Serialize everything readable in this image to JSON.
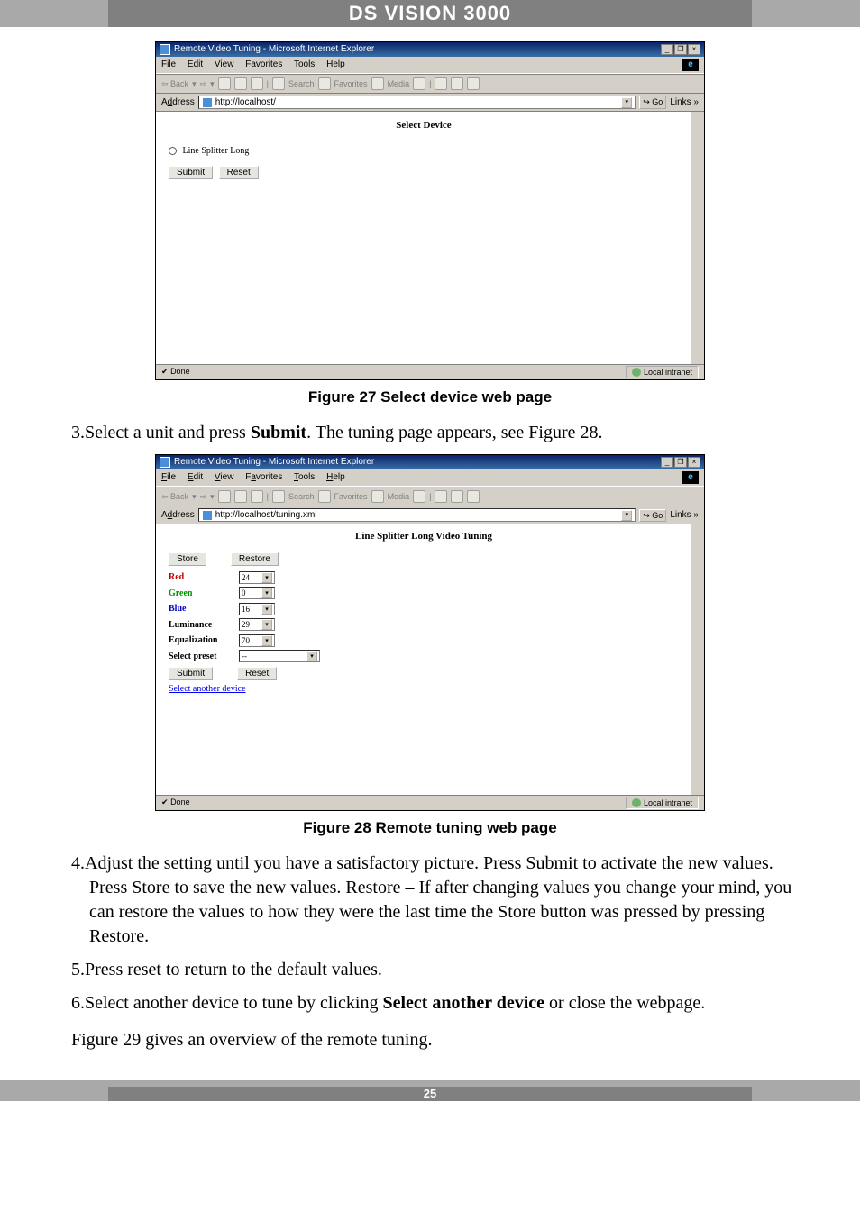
{
  "header": {
    "title": "DS VISION 3000"
  },
  "figure27": {
    "caption": "Figure 27 Select device web page",
    "ie": {
      "title": "Remote Video Tuning - Microsoft Internet Explorer",
      "menu": {
        "file": "File",
        "edit": "Edit",
        "view": "View",
        "favorites": "Favorites",
        "tools": "Tools",
        "help": "Help"
      },
      "toolbar": {
        "back": "Back",
        "search": "Search",
        "favorites": "Favorites",
        "media": "Media"
      },
      "address_label": "Address",
      "address_value": "http://localhost/",
      "go": "Go",
      "links": "Links »",
      "page_title": "Select Device",
      "radio_label": "Line Splitter Long",
      "submit": "Submit",
      "reset": "Reset",
      "status_left": "Done",
      "status_right": "Local intranet"
    }
  },
  "step3": {
    "num": "3.",
    "text_before": "Select a unit and press ",
    "bold": "Submit",
    "text_after": ". The tuning page appears, see Figure 28."
  },
  "figure28": {
    "caption": "Figure 28 Remote tuning web page",
    "ie": {
      "title": "Remote Video Tuning - Microsoft Internet Explorer",
      "address_value": "http://localhost/tuning.xml",
      "page_title": "Line Splitter Long Video Tuning",
      "store": "Store",
      "restore": "Restore",
      "rows": {
        "red": {
          "label": "Red",
          "value": "24"
        },
        "green": {
          "label": "Green",
          "value": "0"
        },
        "blue": {
          "label": "Blue",
          "value": "16"
        },
        "luminance": {
          "label": "Luminance",
          "value": "29"
        },
        "equalization": {
          "label": "Equalization",
          "value": "70"
        },
        "select_preset": {
          "label": "Select preset",
          "value": "--"
        }
      },
      "submit": "Submit",
      "reset": "Reset",
      "select_another": "Select another device",
      "status_left": "Done",
      "status_right": "Local intranet"
    }
  },
  "step4": {
    "num": "4.",
    "text": "Adjust the setting until you have a satisfactory picture. Press Submit to activate the new values. Press Store to save the new values. Restore – If after changing values you change your mind, you can restore the values to how they were the last time the Store button was pressed by pressing Restore."
  },
  "step5": {
    "num": "5.",
    "text": "Press reset to return to the default values."
  },
  "step6": {
    "num": "6.",
    "text_before": "Select another device to tune by clicking ",
    "bold": "Select another device",
    "text_after": " or close the webpage."
  },
  "closing": "Figure 29 gives an overview of the remote tuning.",
  "footer": {
    "page_num": "25"
  }
}
